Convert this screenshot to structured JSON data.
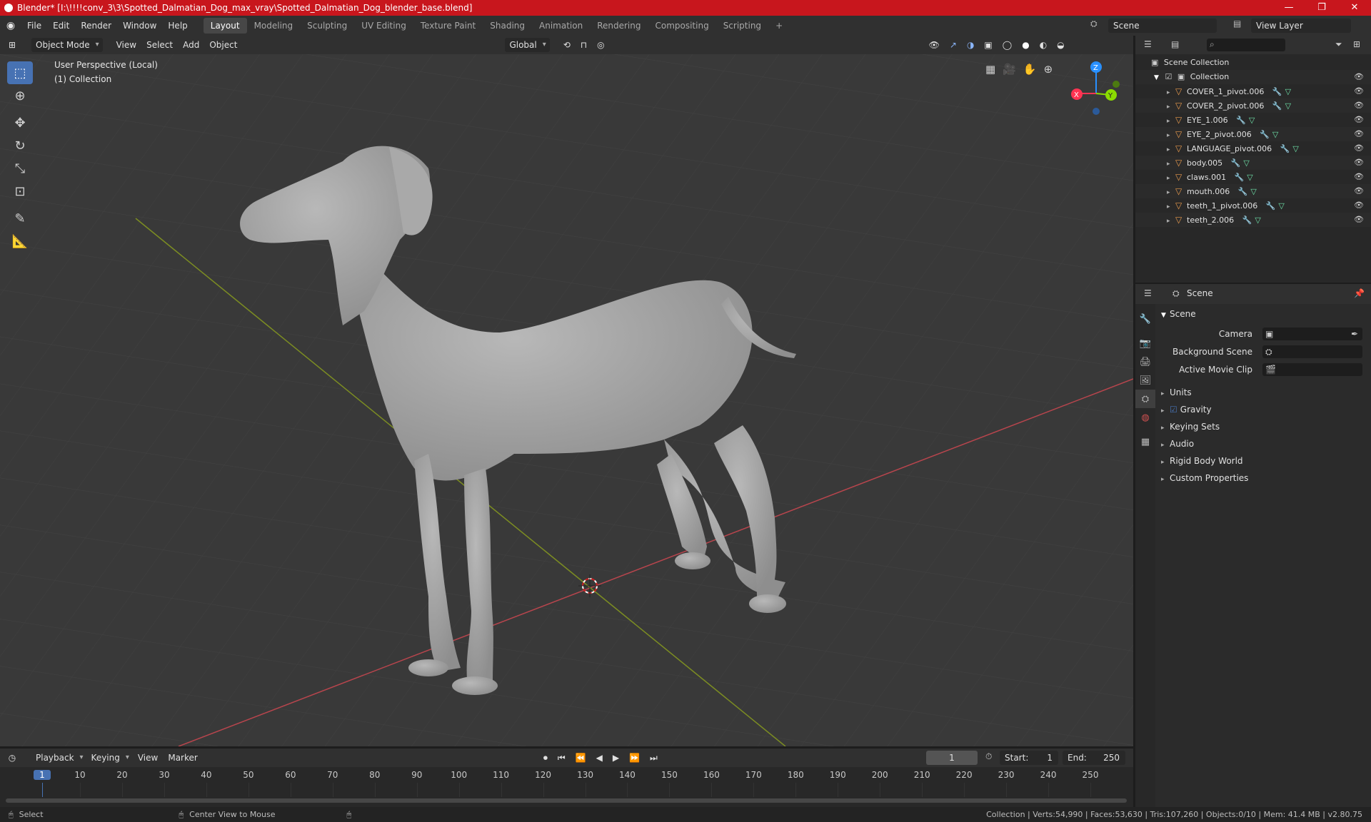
{
  "window": {
    "title": "Blender* [I:\\!!!!conv_3\\3\\Spotted_Dalmatian_Dog_max_vray\\Spotted_Dalmatian_Dog_blender_base.blend]",
    "minimize": "—",
    "maximize": "❐",
    "close": "✕"
  },
  "menu": [
    "File",
    "Edit",
    "Render",
    "Window",
    "Help"
  ],
  "workspaces": [
    "Layout",
    "Modeling",
    "Sculpting",
    "UV Editing",
    "Texture Paint",
    "Shading",
    "Animation",
    "Rendering",
    "Compositing",
    "Scripting"
  ],
  "workspace_add": "+",
  "scene_selector": "Scene",
  "view_layer": "View Layer",
  "viewport_header": {
    "mode": "Object Mode",
    "menus": [
      "View",
      "Select",
      "Add",
      "Object"
    ],
    "transform": "Global"
  },
  "viewport": {
    "perspective": "User Perspective (Local)",
    "collection": "(1) Collection",
    "gizmo": {
      "x": "X",
      "y": "Y",
      "z": "Z"
    }
  },
  "outliner": {
    "root": "Scene Collection",
    "collection": "Collection",
    "items": [
      "COVER_1_pivot.006",
      "COVER_2_pivot.006",
      "EYE_1.006",
      "EYE_2_pivot.006",
      "LANGUAGE_pivot.006",
      "body.005",
      "claws.001",
      "mouth.006",
      "teeth_1_pivot.006",
      "teeth_2.006"
    ]
  },
  "properties": {
    "header": "Scene",
    "section": "Scene",
    "fields": [
      {
        "label": "Camera"
      },
      {
        "label": "Background Scene"
      },
      {
        "label": "Active Movie Clip"
      }
    ],
    "subpanels": [
      "Units",
      "Gravity",
      "Keying Sets",
      "Audio",
      "Rigid Body World",
      "Custom Properties"
    ]
  },
  "timeline": {
    "menus": [
      "Playback",
      "Keying",
      "View",
      "Marker"
    ],
    "current_frame": "1",
    "start_label": "Start:",
    "start": "1",
    "end_label": "End:",
    "end": "250",
    "ticks": [
      "1",
      "10",
      "20",
      "30",
      "40",
      "50",
      "60",
      "70",
      "80",
      "90",
      "100",
      "110",
      "120",
      "130",
      "140",
      "150",
      "160",
      "170",
      "180",
      "190",
      "200",
      "210",
      "220",
      "230",
      "240",
      "250"
    ]
  },
  "status": {
    "left": "Select",
    "middle": "Center View to Mouse",
    "right": "Collection | Verts:54,990 | Faces:53,630 | Tris:107,260 | Objects:0/10 | Mem: 41.4 MB | v2.80.75"
  },
  "colors": {
    "accent": "#4772b3",
    "titlebar": "#c8161d",
    "x_axis": "#ff3352",
    "y_axis": "#8bdc00",
    "z_axis": "#2890ff"
  }
}
